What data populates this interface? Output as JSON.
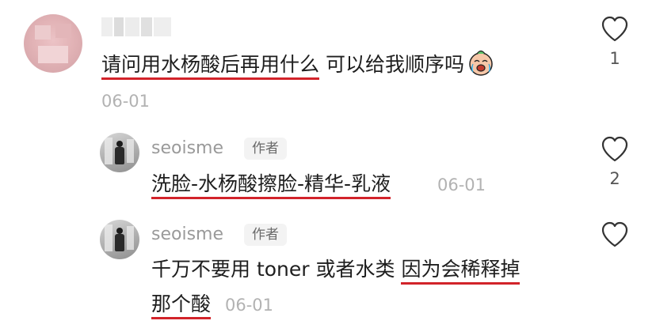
{
  "comments": [
    {
      "text_highlighted": "请问用水杨酸后再用什么",
      "text_rest": " 可以给我顺序吗",
      "emoji": "crying-face-emoji",
      "date": "06-01",
      "likes": "1"
    },
    {
      "username": "seoisme",
      "badge": "作者",
      "text_highlighted": "洗脸-水杨酸擦脸-精华-乳液",
      "date": "06-01",
      "likes": "2"
    },
    {
      "username": "seoisme",
      "badge": "作者",
      "line1_plain": "千万不要用 toner 或者水类 ",
      "line1_highlighted": "因为会稀释掉",
      "line2_highlighted": "那个酸",
      "date": "06-01"
    }
  ],
  "colors": {
    "underline": "#d2232a",
    "date": "#b2b2b2",
    "username": "#9a9a9a"
  }
}
